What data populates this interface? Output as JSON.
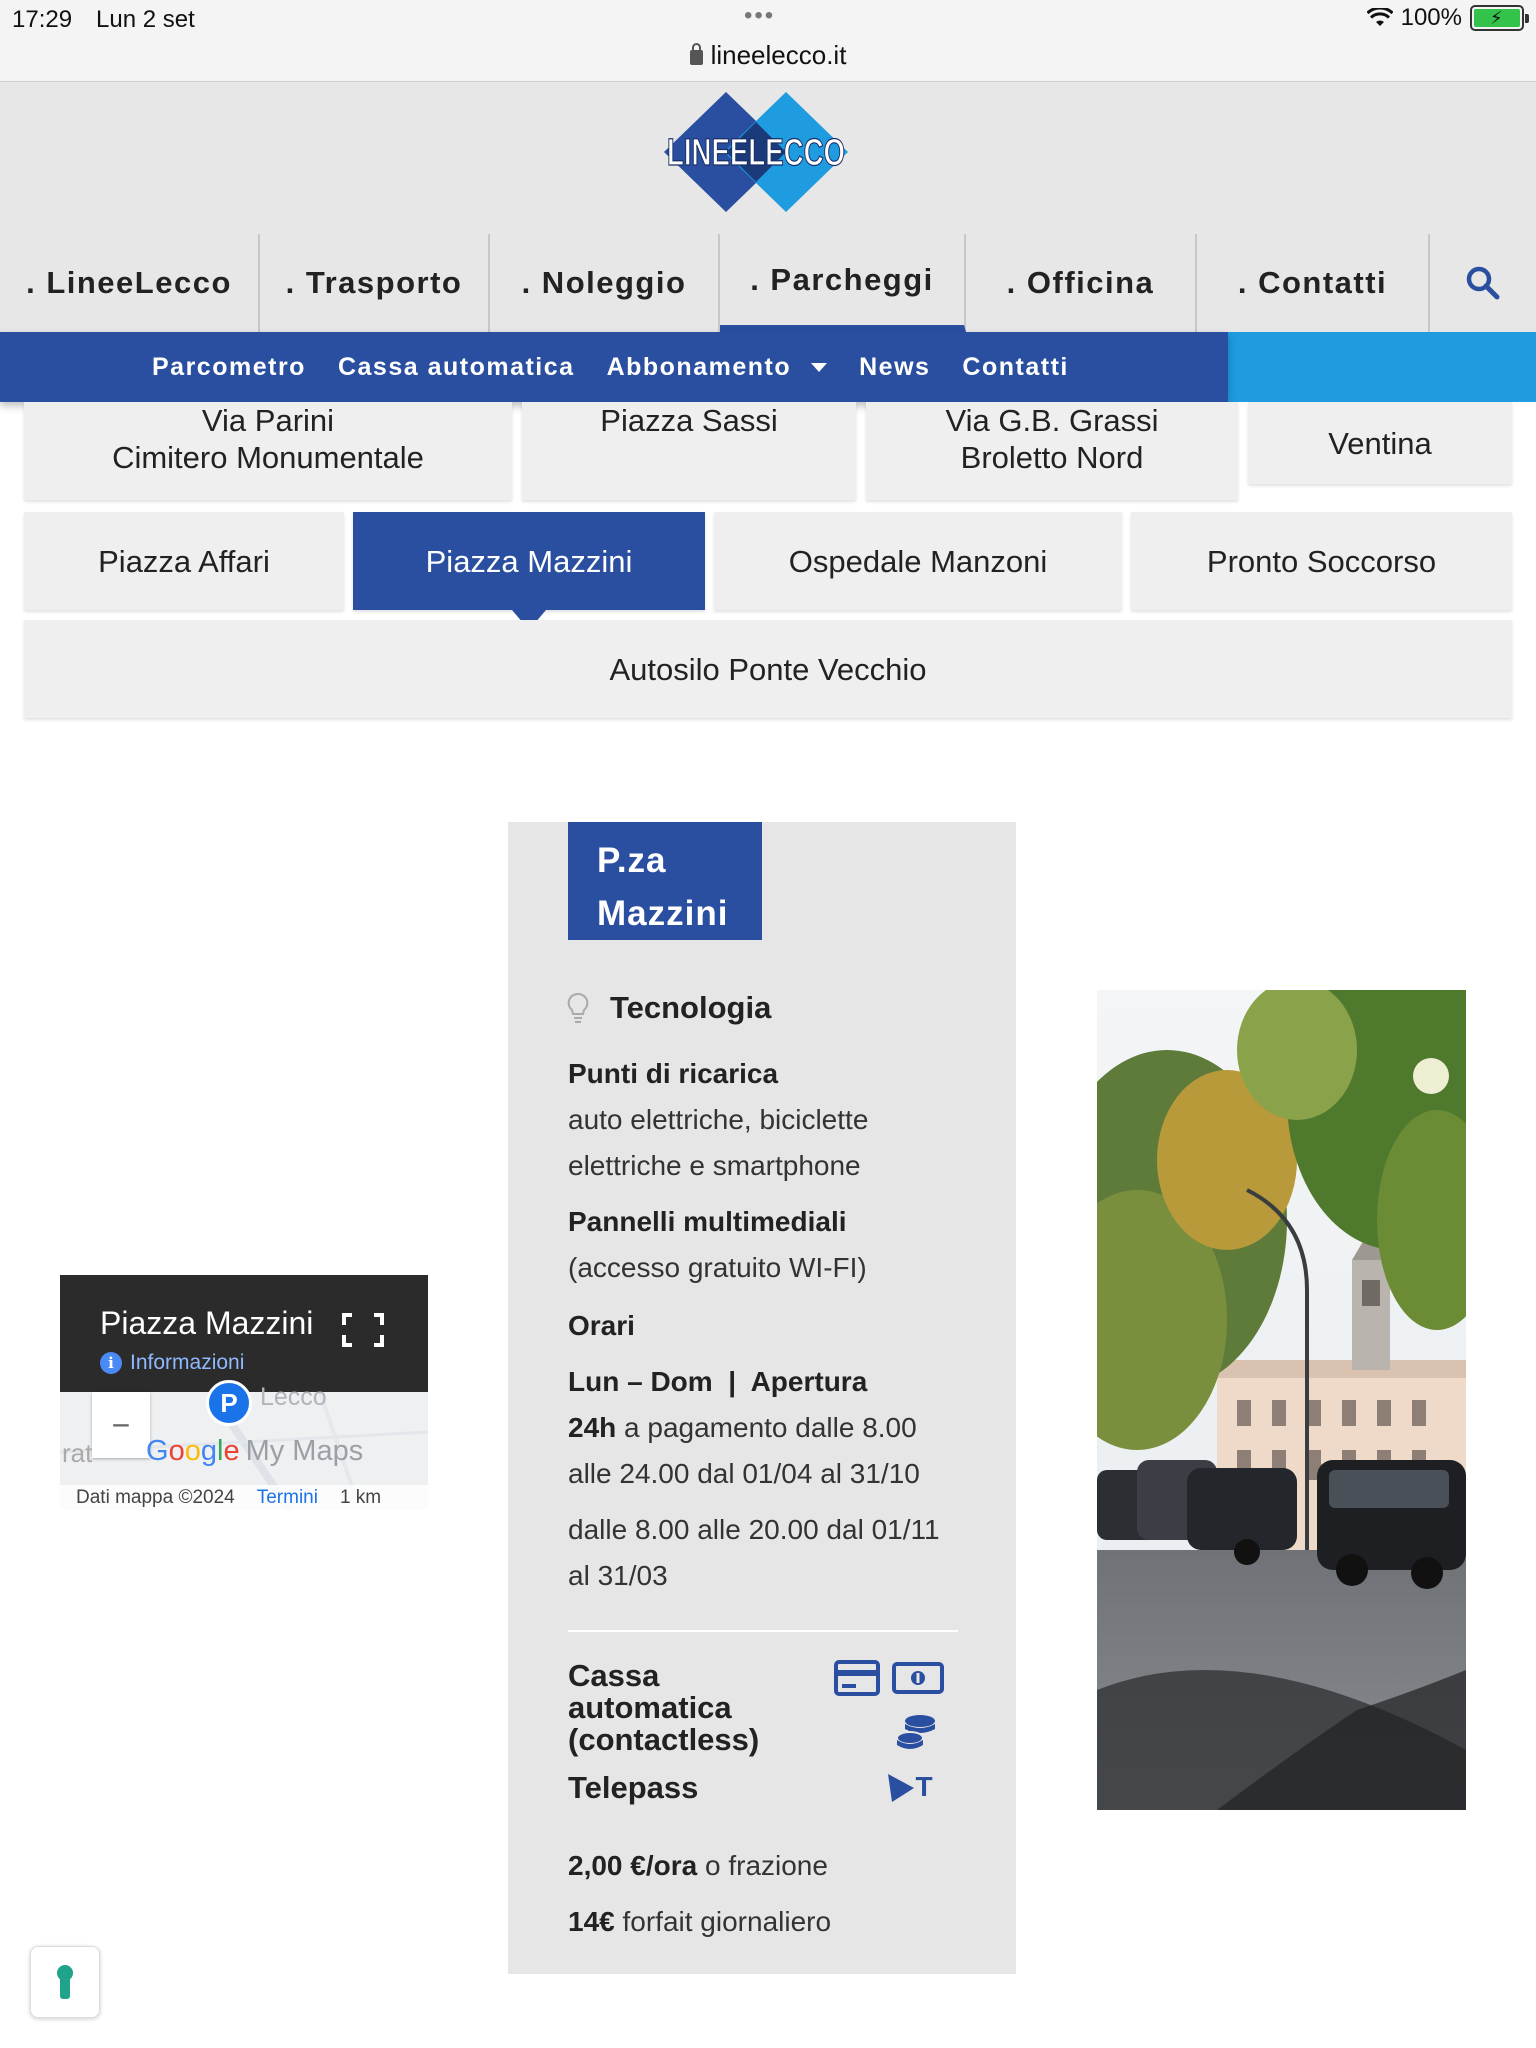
{
  "status_bar": {
    "time": "17:29",
    "date": "Lun 2 set",
    "battery": "100%",
    "url": "lineelecco.it"
  },
  "header": {
    "logo_text": "LINEELECCO",
    "nav": [
      {
        "label": ". LineeLecco"
      },
      {
        "label": ". Trasporto"
      },
      {
        "label": ". Noleggio"
      },
      {
        "label": ". Parcheggi",
        "active": true
      },
      {
        "label": ". Officina"
      },
      {
        "label": ". Contatti"
      }
    ]
  },
  "subnav": [
    {
      "label": "Parcometro"
    },
    {
      "label": "Cassa automatica"
    },
    {
      "label": "Abbonamento"
    },
    {
      "label": "News"
    },
    {
      "label": "Contatti"
    }
  ],
  "parking_tabs": {
    "row1": [
      {
        "line1": "Via Parini",
        "line2": "Cimitero Monumentale"
      },
      {
        "line1": "Piazza Sassi",
        "line2": ""
      },
      {
        "line1": "Via G.B. Grassi",
        "line2": "Broletto Nord"
      },
      {
        "line1": "Ventina",
        "line2": ""
      }
    ],
    "row2": [
      {
        "label": "Piazza Affari"
      },
      {
        "label": "Piazza Mazzini",
        "active": true
      },
      {
        "label": "Ospedale Manzoni"
      },
      {
        "label": "Pronto Soccorso"
      }
    ],
    "row3": [
      {
        "label": "Autosilo Ponte Vecchio"
      }
    ]
  },
  "map": {
    "title": "Piazza Mazzini",
    "info": "Informazioni",
    "place": "Lecco",
    "rat_fragment": "rat",
    "google": [
      "G",
      "o",
      "o",
      "g",
      "l",
      "e"
    ],
    "mymaps": "My Maps",
    "data_credit": "Dati mappa ©2024",
    "terms": "Termini",
    "scale": "1 km"
  },
  "card": {
    "title_line1": "P.za",
    "title_line2": "Mazzini",
    "tech_label": "Tecnologia",
    "ricarica_title": "Punti di ricarica",
    "ricarica_line1": "auto elettriche, biciclette",
    "ricarica_line2": "elettriche e smartphone",
    "pannelli_title": "Pannelli multimediali",
    "pannelli_desc": "(accesso gratuito WI-FI)",
    "orari_title": "Orari",
    "orari_days": "Lun – Dom  |  Apertura",
    "orari_24h": "24h",
    "orari_line1_rest": " a pagamento dalle 8.00",
    "orari_line2": "alle 24.00 dal 01/04 al 31/10",
    "orari_line3": "dalle 8.00 alle 20.00 dal 01/11",
    "orari_line4": "al 31/03",
    "cassa_line1": "Cassa",
    "cassa_line2": "automatica",
    "cassa_line3": "(contactless)",
    "telepass": "Telepass",
    "telepass_icon_letter": "T",
    "price_hour_bold": "2,00 €/ora",
    "price_hour_rest": " o frazione",
    "price_day_bold": "14€",
    "price_day_rest": " forfait giornaliero"
  },
  "colors": {
    "brand_blue": "#2a4fa0",
    "accent_cyan": "#1f9be0",
    "header_bg": "#e7e7e7",
    "card_bg": "#e6e6e6"
  },
  "icons": {
    "search": "search-icon",
    "bulb": "lightbulb-icon",
    "card": "credit-card-icon",
    "banknote": "banknote-icon",
    "coins": "coins-icon",
    "telepass": "telepass-icon",
    "fullscreen": "fullscreen-icon",
    "info": "info-icon",
    "accessibility": "keyhole-icon"
  }
}
